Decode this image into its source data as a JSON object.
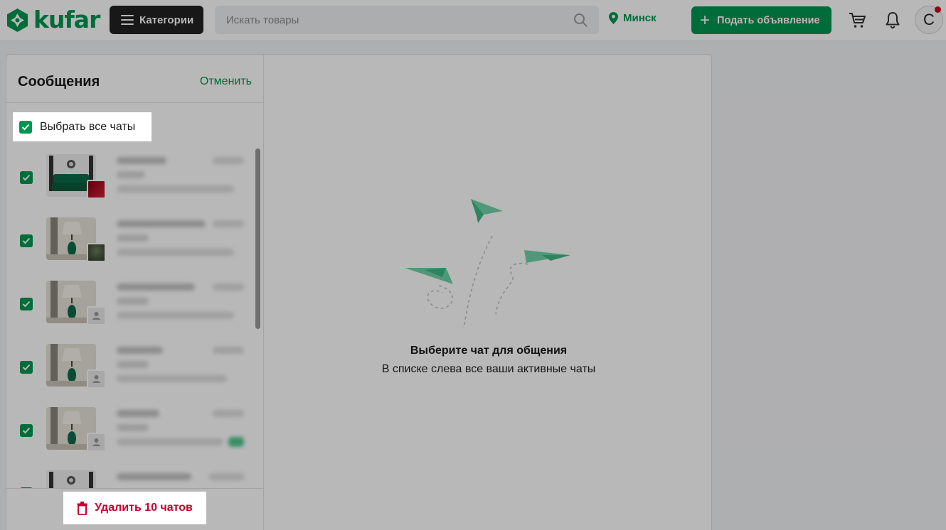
{
  "header": {
    "logo_text": "kufar",
    "categories_label": "Категории",
    "search_placeholder": "Искать товары",
    "city": "Минск",
    "post_ad_label": "Подать объявление",
    "avatar_letter": "С"
  },
  "messages": {
    "title": "Сообщения",
    "cancel_label": "Отменить",
    "select_all_label": "Выбрать все чаты",
    "select_all_checked": true,
    "chats": [
      {
        "checked": true,
        "thumb": "sofa",
        "corner": "red"
      },
      {
        "checked": true,
        "thumb": "lamp",
        "corner": "photo"
      },
      {
        "checked": true,
        "thumb": "lamp",
        "corner": "user"
      },
      {
        "checked": true,
        "thumb": "lamp",
        "corner": "user"
      },
      {
        "checked": true,
        "thumb": "lamp",
        "corner": "user"
      },
      {
        "checked": true,
        "thumb": "sofa",
        "corner": "none"
      }
    ],
    "delete_label": "Удалить 10 чатов"
  },
  "empty_state": {
    "title": "Выберите чат для общения",
    "subtitle": "В списке слева все ваши активные чаты"
  },
  "colors": {
    "brand_green": "#009650",
    "danger_red": "#c5002f",
    "notification_dot": "#d0021b"
  }
}
